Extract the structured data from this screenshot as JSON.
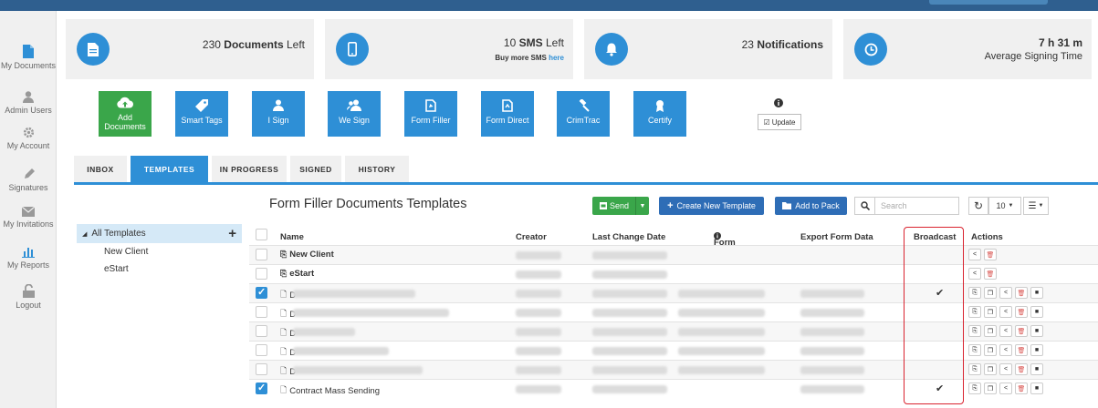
{
  "sidebar": {
    "items": [
      {
        "label": "My Documents",
        "icon": "document-icon"
      },
      {
        "label": "Admin Users",
        "icon": "user-icon"
      },
      {
        "label": "My Account",
        "icon": "gear-icon"
      },
      {
        "label": "Signatures",
        "icon": "pencil-icon"
      },
      {
        "label": "My Invitations",
        "icon": "envelope-icon"
      },
      {
        "label": "My Reports",
        "icon": "bar-chart-icon"
      },
      {
        "label": "Logout",
        "icon": "unlock-icon"
      }
    ]
  },
  "stats": {
    "documents": {
      "value": "230",
      "bold": "Documents",
      "rest": " Left"
    },
    "sms": {
      "value": "10",
      "bold": "SMS",
      "rest": " Left",
      "sub_prefix": "Buy more SMS ",
      "sub_link": "here"
    },
    "notifications": {
      "value": "23",
      "bold": "Notifications"
    },
    "signing_time": {
      "value": "7 h 31 m",
      "label": "Average Signing Time"
    }
  },
  "actions": [
    {
      "label": "Add\nDocuments",
      "icon": "cloud-upload-icon",
      "color": "#3aa64a"
    },
    {
      "label": "Smart Tags",
      "icon": "tag-icon"
    },
    {
      "label": "I Sign",
      "icon": "user-icon"
    },
    {
      "label": "We Sign",
      "icon": "users-icon"
    },
    {
      "label": "Form Filler",
      "icon": "form-icon"
    },
    {
      "label": "Form Direct",
      "icon": "form-direct-icon"
    },
    {
      "label": "CrimTrac",
      "icon": "gavel-icon"
    },
    {
      "label": "Certify",
      "icon": "certificate-icon"
    }
  ],
  "update_label": "Update",
  "tabs": [
    "INBOX",
    "TEMPLATES",
    "IN PROGRESS",
    "SIGNED",
    "HISTORY"
  ],
  "active_tab": "TEMPLATES",
  "page_title": "Form Filler Documents Templates",
  "toolbar": {
    "send_label": "Send",
    "create_label": "Create New Template",
    "add_pack_label": "Add to Pack",
    "search_placeholder": "Search",
    "page_size": "10"
  },
  "tree": {
    "root": "All Templates",
    "items": [
      "New Client",
      "eStart"
    ]
  },
  "table": {
    "columns": [
      "Name",
      "Creator",
      "Last Change Date",
      "Form URL",
      "Export Form Data",
      "Broadcast",
      "Actions"
    ],
    "rows": [
      {
        "name": "New Client",
        "bold": true,
        "checked": false,
        "broadcast": false,
        "full_actions": false
      },
      {
        "name": "eStart",
        "bold": true,
        "checked": false,
        "broadcast": false,
        "full_actions": false
      },
      {
        "name": "D",
        "bold": false,
        "checked": true,
        "broadcast": true,
        "full_actions": true
      },
      {
        "name": "D",
        "bold": false,
        "checked": false,
        "broadcast": false,
        "full_actions": true
      },
      {
        "name": "D",
        "bold": false,
        "checked": false,
        "broadcast": false,
        "full_actions": true
      },
      {
        "name": "D",
        "bold": false,
        "checked": false,
        "broadcast": false,
        "full_actions": true
      },
      {
        "name": "D",
        "bold": false,
        "checked": false,
        "broadcast": false,
        "full_actions": true
      },
      {
        "name": "Contract Mass Sending",
        "bold": false,
        "checked": true,
        "broadcast": true,
        "full_actions": true
      }
    ]
  },
  "colors": {
    "primary": "#2e8fd6",
    "success": "#3aa64a",
    "highlight": "#d9232f"
  }
}
